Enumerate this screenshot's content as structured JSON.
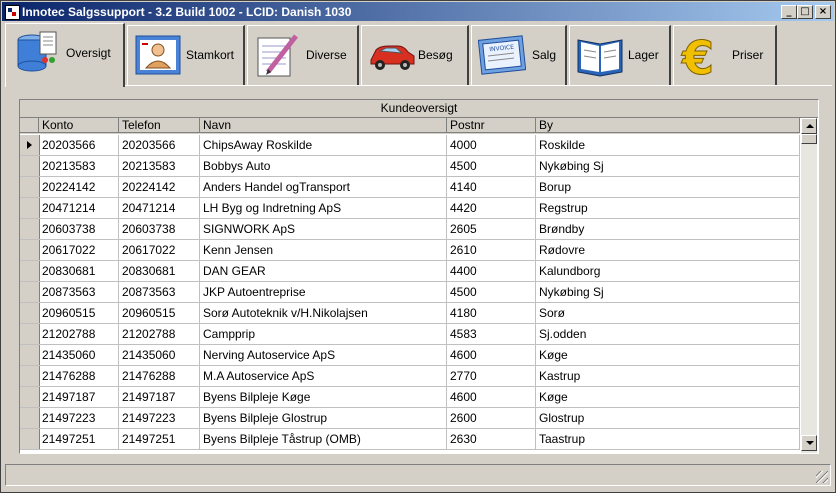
{
  "window": {
    "title": "Innotec Salgssupport -  3.2 Build 1002 - LCID: Danish 1030",
    "controls": {
      "minimize": "_",
      "maximize": "□",
      "close": "×"
    }
  },
  "tabs": [
    {
      "label": "Oversigt",
      "icon": "database-icon",
      "active": true
    },
    {
      "label": "Stamkort",
      "icon": "person-card-icon",
      "active": false
    },
    {
      "label": "Diverse",
      "icon": "notepad-pen-icon",
      "active": false
    },
    {
      "label": "Besøg",
      "icon": "car-icon",
      "active": false
    },
    {
      "label": "Salg",
      "icon": "invoice-icon",
      "active": false
    },
    {
      "label": "Lager",
      "icon": "book-icon",
      "active": false
    },
    {
      "label": "Priser",
      "icon": "euro-icon",
      "active": false
    }
  ],
  "grid": {
    "title": "Kundeoversigt",
    "columns": [
      "Konto",
      "Telefon",
      "Navn",
      "Postnr",
      "By"
    ],
    "rows": [
      [
        "20203566",
        "20203566",
        "ChipsAway Roskilde",
        "4000",
        "Roskilde"
      ],
      [
        "20213583",
        "20213583",
        "Bobbys Auto",
        "4500",
        "Nykøbing Sj"
      ],
      [
        "20224142",
        "20224142",
        "Anders Handel ogTransport",
        "4140",
        "Borup"
      ],
      [
        "20471214",
        "20471214",
        "LH Byg og Indretning ApS",
        "4420",
        "Regstrup"
      ],
      [
        "20603738",
        "20603738",
        "SIGNWORK ApS",
        "2605",
        "Brøndby"
      ],
      [
        "20617022",
        "20617022",
        "Kenn Jensen",
        "2610",
        "Rødovre"
      ],
      [
        "20830681",
        "20830681",
        "DAN GEAR",
        "4400",
        "Kalundborg"
      ],
      [
        "20873563",
        "20873563",
        "JKP Autoentreprise",
        "4500",
        "Nykøbing Sj"
      ],
      [
        "20960515",
        "20960515",
        "Sorø Autoteknik v/H.Nikolajsen",
        "4180",
        "Sorø"
      ],
      [
        "21202788",
        "21202788",
        "Campprip",
        "4583",
        "Sj.odden"
      ],
      [
        "21435060",
        "21435060",
        "Nerving Autoservice ApS",
        "4600",
        "Køge"
      ],
      [
        "21476288",
        "21476288",
        "M.A Autoservice ApS",
        "2770",
        "Kastrup"
      ],
      [
        "21497187",
        "21497187",
        "Byens Bilpleje Køge",
        "4600",
        "Køge"
      ],
      [
        "21497223",
        "21497223",
        "Byens Bilpleje Glostrup",
        "2600",
        "Glostrup"
      ],
      [
        "21497251",
        "21497251",
        "Byens Bilpleje Tåstrup (OMB)",
        "2630",
        "Taastrup"
      ]
    ],
    "selected_row": 0
  },
  "status": {
    "text": ""
  }
}
